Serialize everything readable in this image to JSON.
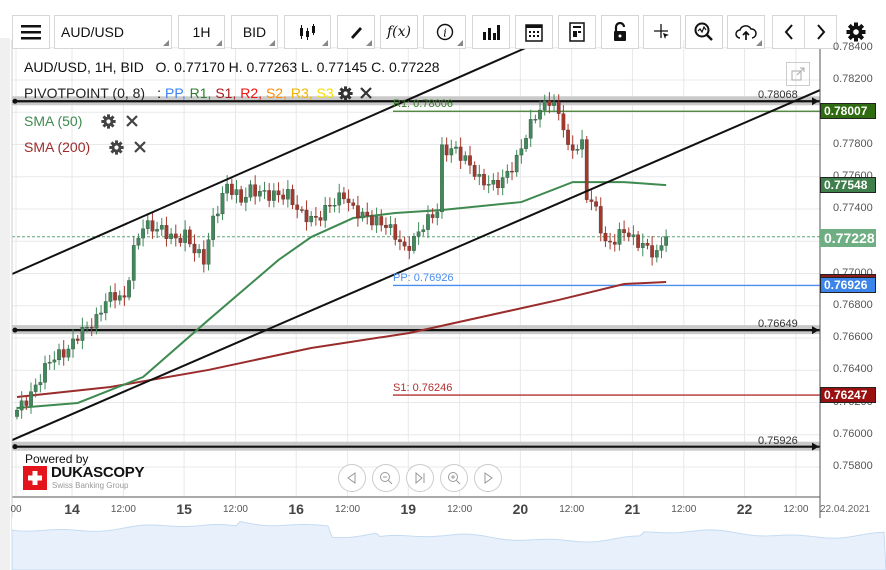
{
  "toolbar": {
    "menu_icon": "hamburger-icon",
    "instrument": "AUD/USD",
    "timeframe": "1H",
    "side": "BID",
    "buttons": [
      "candle-type-icon",
      "pencil-icon",
      "function-icon",
      "info-icon",
      "bar-chart-icon",
      "calendar-icon",
      "report-icon",
      "lock-icon",
      "crosshair-icon",
      "zoom-icon",
      "cloud-upload-icon",
      "chevron-left-icon",
      "chevron-right-icon",
      "gear-icon"
    ],
    "fx_label": "f(x)"
  },
  "legend": {
    "title": "AUD/USD, 1H, BID",
    "ohlc": "O. 0.77170 H. 0.77263 L. 0.77145 C. 0.77228",
    "pivot_name": "PIVOTPOINT (0, 8)",
    "pivot_sep": ":",
    "pivot_items": [
      {
        "label": "PP",
        "color": "#3b82f6"
      },
      {
        "label": "R1",
        "color": "#2e7d32"
      },
      {
        "label": "S1",
        "color": "#a61b1b"
      },
      {
        "label": "R2",
        "color": "#ee1111"
      },
      {
        "label": "S2",
        "color": "#ff8c00"
      },
      {
        "label": "R3",
        "color": "#f0b400"
      },
      {
        "label": "S3",
        "color": "#f5e000"
      }
    ],
    "indicators": [
      {
        "label": "SMA (50)",
        "color": "#3f8a50"
      },
      {
        "label": "SMA (200)",
        "color": "#9b2c2c"
      }
    ]
  },
  "footer": {
    "powered_by": "Powered by",
    "brand": "DUKASCOPY",
    "brand_sub": "Swiss Banking Group",
    "nav_buttons": [
      "scroll-left-icon",
      "zoom-out-icon",
      "go-to-end-icon",
      "zoom-in-icon",
      "scroll-right-icon"
    ]
  },
  "chart_data": {
    "type": "candlestick",
    "symbol": "AUD/USD",
    "timeframe": "1H",
    "ylim": [
      0.7572,
      0.7845
    ],
    "y_ticks": [
      "0.78400",
      "0.78200",
      "0.78000",
      "0.77800",
      "0.77600",
      "0.77400",
      "0.77200",
      "0.77000",
      "0.76800",
      "0.76600",
      "0.76400",
      "0.76200",
      "0.76000",
      "0.75800"
    ],
    "x_ticks": [
      {
        "bar": 0,
        "label": "00",
        "day": false
      },
      {
        "bar": 12,
        "label": "14",
        "day": true
      },
      {
        "bar": 23,
        "label": "12:00",
        "day": false
      },
      {
        "bar": 36,
        "label": "15",
        "day": true
      },
      {
        "bar": 47,
        "label": "12:00",
        "day": false
      },
      {
        "bar": 60,
        "label": "16",
        "day": true
      },
      {
        "bar": 71,
        "label": "12:00",
        "day": false
      },
      {
        "bar": 84,
        "label": "19",
        "day": true
      },
      {
        "bar": 95,
        "label": "12:00",
        "day": false
      },
      {
        "bar": 108,
        "label": "20",
        "day": true
      },
      {
        "bar": 119,
        "label": "12:00",
        "day": false
      },
      {
        "bar": 132,
        "label": "21",
        "day": true
      },
      {
        "bar": 143,
        "label": "12:00",
        "day": false
      },
      {
        "bar": 156,
        "label": "22",
        "day": true
      },
      {
        "bar": 167,
        "label": "12:00",
        "day": false
      }
    ],
    "cursor_date": "22.04.2021",
    "close_waypoints": [
      [
        0,
        0.76153
      ],
      [
        3,
        0.76247
      ],
      [
        7,
        0.76464
      ],
      [
        11,
        0.76526
      ],
      [
        13,
        0.76619
      ],
      [
        17,
        0.76712
      ],
      [
        19,
        0.76836
      ],
      [
        21,
        0.76867
      ],
      [
        23,
        0.76836
      ],
      [
        25,
        0.77146
      ],
      [
        27,
        0.77301
      ],
      [
        31,
        0.7727
      ],
      [
        34,
        0.77208
      ],
      [
        36,
        0.77239
      ],
      [
        38,
        0.77146
      ],
      [
        40,
        0.77084
      ],
      [
        42,
        0.77332
      ],
      [
        45,
        0.77549
      ],
      [
        48,
        0.77456
      ],
      [
        50,
        0.77518
      ],
      [
        54,
        0.77487
      ],
      [
        58,
        0.77487
      ],
      [
        61,
        0.77363
      ],
      [
        64,
        0.77332
      ],
      [
        67,
        0.77425
      ],
      [
        70,
        0.77487
      ],
      [
        72,
        0.77394
      ],
      [
        76,
        0.77332
      ],
      [
        79,
        0.77301
      ],
      [
        81,
        0.77239
      ],
      [
        83,
        0.77146
      ],
      [
        85,
        0.77208
      ],
      [
        87,
        0.77301
      ],
      [
        90,
        0.77394
      ],
      [
        91,
        0.77766
      ],
      [
        94,
        0.77766
      ],
      [
        97,
        0.77673
      ],
      [
        99,
        0.7758
      ],
      [
        102,
        0.77549
      ],
      [
        104,
        0.7758
      ],
      [
        107,
        0.77704
      ],
      [
        109,
        0.77859
      ],
      [
        111,
        0.77983
      ],
      [
        114,
        0.78076
      ],
      [
        115,
        0.78045
      ],
      [
        117,
        0.77921
      ],
      [
        118,
        0.77766
      ],
      [
        121,
        0.77797
      ],
      [
        122,
        0.77487
      ],
      [
        124,
        0.77394
      ],
      [
        126,
        0.77177
      ],
      [
        128,
        0.77208
      ],
      [
        130,
        0.7727
      ],
      [
        132,
        0.77208
      ],
      [
        134,
        0.77177
      ],
      [
        137,
        0.77115
      ],
      [
        138,
        0.77177
      ],
      [
        139,
        0.77228
      ]
    ],
    "sma50": [
      [
        0,
        0.76166
      ],
      [
        13,
        0.76197
      ],
      [
        27,
        0.76358
      ],
      [
        41,
        0.76712
      ],
      [
        56,
        0.77084
      ],
      [
        63,
        0.77226
      ],
      [
        72,
        0.77344
      ],
      [
        81,
        0.77375
      ],
      [
        91,
        0.77394
      ],
      [
        108,
        0.77443
      ],
      [
        119,
        0.77567
      ],
      [
        130,
        0.77567
      ],
      [
        139,
        0.77548
      ]
    ],
    "sma200": [
      [
        0,
        0.76234
      ],
      [
        20,
        0.76296
      ],
      [
        41,
        0.76402
      ],
      [
        63,
        0.76538
      ],
      [
        84,
        0.76631
      ],
      [
        116,
        0.76836
      ],
      [
        130,
        0.76935
      ],
      [
        139,
        0.76947
      ]
    ],
    "trendlines": [
      {
        "name": "upper-channel",
        "from": [
          0,
          0.7701
        ],
        "to": [
          109,
          0.784
        ]
      },
      {
        "name": "lower-channel",
        "from": [
          0,
          0.7598
        ],
        "to": [
          172,
          0.78138
        ]
      }
    ],
    "horizontal_lines": [
      {
        "value": 0.78068,
        "label": "0.78068"
      },
      {
        "value": 0.76649,
        "label": "0.76649"
      },
      {
        "value": 0.75926,
        "label": "0.75926"
      }
    ],
    "pivot_levels": [
      {
        "name": "R1",
        "value": 0.78006,
        "label": "R1: 0.78006",
        "color": "#3d7a2a"
      },
      {
        "name": "PP",
        "value": 0.76926,
        "label": "PP: 0.76926",
        "color": "#4a8ef0"
      },
      {
        "name": "S1",
        "value": 0.76246,
        "label": "S1: 0.76246",
        "color": "#b03030"
      }
    ],
    "current_price": 0.77228,
    "price_badges": [
      {
        "name": "r1-badge",
        "value": 0.78007,
        "label": "0.78007",
        "color": "#2f6b10"
      },
      {
        "name": "sma50-badge",
        "value": 0.77548,
        "label": "0.77548",
        "color": "#3f7f4c"
      },
      {
        "name": "current-price-badge",
        "value": 0.77228,
        "label": "0.77228",
        "color": "#6fae83"
      },
      {
        "name": "sma200-badge",
        "value": 0.76947,
        "label": "",
        "color": "#8b1a1a"
      },
      {
        "name": "pp-badge",
        "value": 0.76926,
        "label": "0.76926",
        "color": "#3a84ea"
      },
      {
        "name": "s1-badge",
        "value": 0.76247,
        "label": "0.76247",
        "color": "#9a0f0f"
      }
    ]
  }
}
